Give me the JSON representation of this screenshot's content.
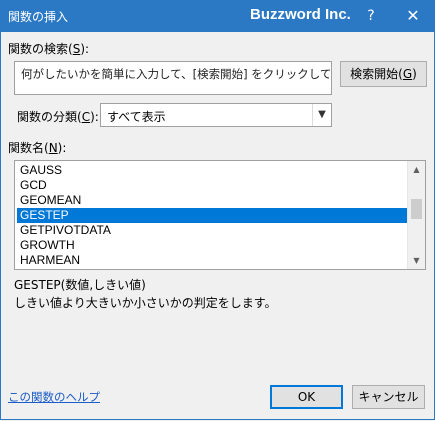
{
  "window": {
    "title": "関数の挿入",
    "brand": "Buzzword Inc.",
    "help_glyph": "?",
    "close_glyph": "✕"
  },
  "search": {
    "label": "関数の検索(",
    "label_key": "S",
    "label_end": "):",
    "value": "何がしたいかを簡単に入力して、[検索開始] をクリックしてください。",
    "button_label": "検索開始(",
    "button_key": "G",
    "button_end": ")"
  },
  "category": {
    "label": "関数の分類(",
    "label_key": "C",
    "label_end": "):",
    "selected": "すべて表示"
  },
  "function_list": {
    "label": "関数名(",
    "label_key": "N",
    "label_end": "):",
    "items": [
      "GAUSS",
      "GCD",
      "GEOMEAN",
      "GESTEP",
      "GETPIVOTDATA",
      "GROWTH",
      "HARMEAN"
    ],
    "selected_index": 3
  },
  "details": {
    "syntax": "GESTEP(数値,しきい値)",
    "description": "しきい値より大きいか小さいかの判定をします。"
  },
  "footer": {
    "help_link": "この関数のヘルプ",
    "ok_label": "OK",
    "cancel_label": "キャンセル"
  }
}
